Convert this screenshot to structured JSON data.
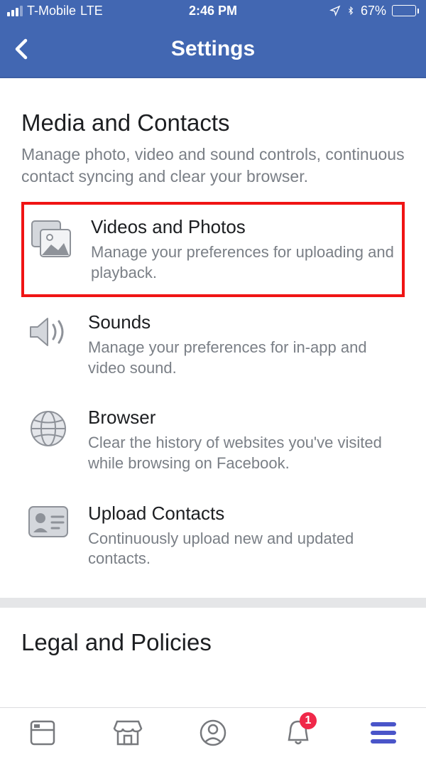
{
  "status": {
    "carrier": "T-Mobile",
    "network": "LTE",
    "time": "2:46 PM",
    "battery_pct": "67%"
  },
  "nav": {
    "title": "Settings"
  },
  "section": {
    "title": "Media and Contacts",
    "desc": "Manage photo, video and sound controls, continuous contact syncing and clear your browser."
  },
  "rows": [
    {
      "title": "Videos and Photos",
      "desc": "Manage your preferences for uploading and playback."
    },
    {
      "title": "Sounds",
      "desc": "Manage your preferences for in-app and video sound."
    },
    {
      "title": "Browser",
      "desc": "Clear the history of websites you've visited while browsing on Facebook."
    },
    {
      "title": "Upload Contacts",
      "desc": "Continuously upload new and updated contacts."
    }
  ],
  "section2": {
    "title": "Legal and Policies"
  },
  "tabs": {
    "notification_badge": "1"
  }
}
